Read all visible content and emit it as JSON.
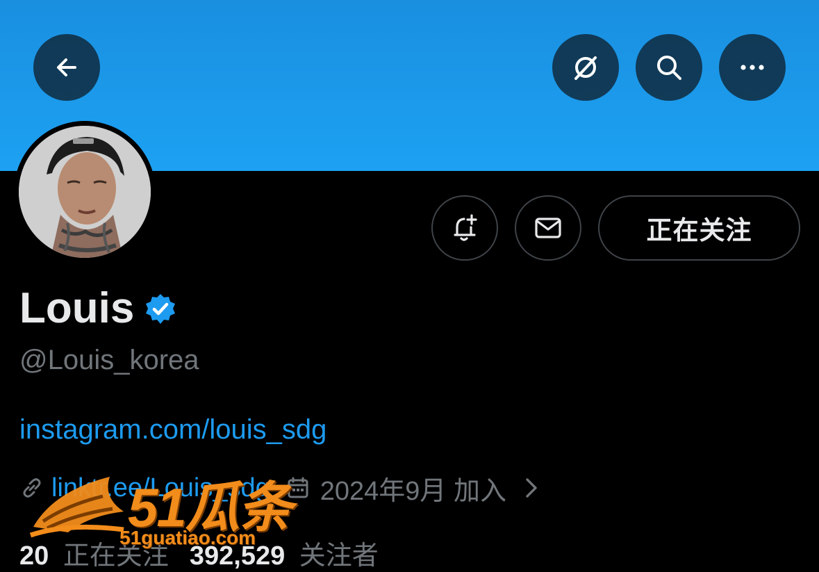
{
  "profile": {
    "name": "Louis",
    "handle": "@Louis_korea",
    "bio_link": "instagram.com/louis_sdg",
    "website": "linktr.ee/Louis_sdg",
    "joined": "2024年9月 加入",
    "following_count": "20",
    "following_label": "正在关注",
    "followers_count": "392,529",
    "followers_label": "关注者"
  },
  "actions": {
    "follow_state_label": "正在关注"
  },
  "header": {
    "icons": [
      "back-arrow-icon",
      "grok-icon",
      "search-icon",
      "more-icon"
    ]
  },
  "watermark": {
    "brand": "51瓜条",
    "url": "51guatiao.com"
  },
  "colors": {
    "banner": "#1da1f2",
    "accent": "#1d9bf0",
    "muted": "#71767b",
    "text": "#e7e9ea",
    "watermark": "#f28c1b"
  }
}
